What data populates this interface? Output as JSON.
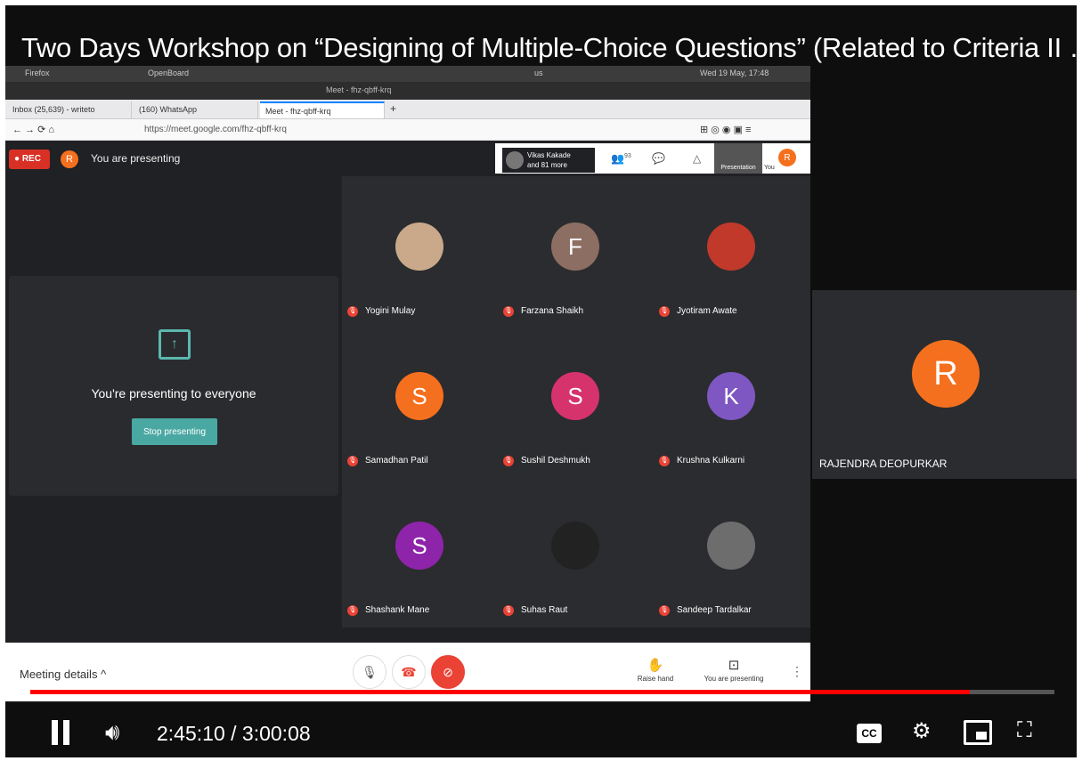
{
  "video_title": "Two Days Workshop on “Designing of Multiple-Choice Questions” (Related to Criteria II …",
  "os_bar": {
    "app1": "Firefox",
    "app2": "OpenBoard",
    "keyboard": "us",
    "clock": "Wed 19 May, 17:48"
  },
  "window_title": "Meet - fhz-qbff-krq",
  "tabs": [
    {
      "label": "Inbox (25,639) - writeto",
      "active": false
    },
    {
      "label": "(160) WhatsApp",
      "active": false
    },
    {
      "label": "Meet - fhz-qbff-krq",
      "active": true
    }
  ],
  "url": "https://meet.google.com/fhz-qbff-krq",
  "meet": {
    "rec_label": "REC",
    "me_initial": "R",
    "presenting_label": "You are presenting",
    "top_participant": "Vikas Kakade",
    "top_participant_more": "and 81 more",
    "people_count": "93",
    "mini_presentation_label": "Presentation",
    "mini_you_label": "You",
    "present_message": "You're presenting to everyone",
    "stop_presenting": "Stop presenting",
    "participants": [
      {
        "name": "Yogini Mulay",
        "initial": "",
        "color": "#c9a98a",
        "photo": true
      },
      {
        "name": "Farzana Shaikh",
        "initial": "F",
        "color": "#8d6e63",
        "photo": false
      },
      {
        "name": "Jyotiram Awate",
        "initial": "",
        "color": "#c0392b",
        "photo": true
      },
      {
        "name": "Samadhan Patil",
        "initial": "S",
        "color": "#f5701e",
        "photo": false
      },
      {
        "name": "Sushil Deshmukh",
        "initial": "S",
        "color": "#d6336c",
        "photo": false
      },
      {
        "name": "Krushna Kulkarni",
        "initial": "K",
        "color": "#7e57c2",
        "photo": false
      },
      {
        "name": "Shashank Mane",
        "initial": "S",
        "color": "#8e24aa",
        "photo": false
      },
      {
        "name": "Suhas Raut",
        "initial": "",
        "color": "#222",
        "photo": true
      },
      {
        "name": "Sandeep Tardalkar",
        "initial": "",
        "color": "#6d6d6d",
        "photo": true
      }
    ],
    "meeting_details": "Meeting details",
    "raise_hand": "Raise hand",
    "you_are_presenting": "You are presenting"
  },
  "right_tile": {
    "initial": "R",
    "name": "RAJENDRA DEOPURKAR"
  },
  "player": {
    "current_time": "2:45:10",
    "duration": "3:00:08",
    "time_display": "2:45:10 / 3:00:08",
    "progress": 0.917,
    "cc_label": "CC"
  }
}
